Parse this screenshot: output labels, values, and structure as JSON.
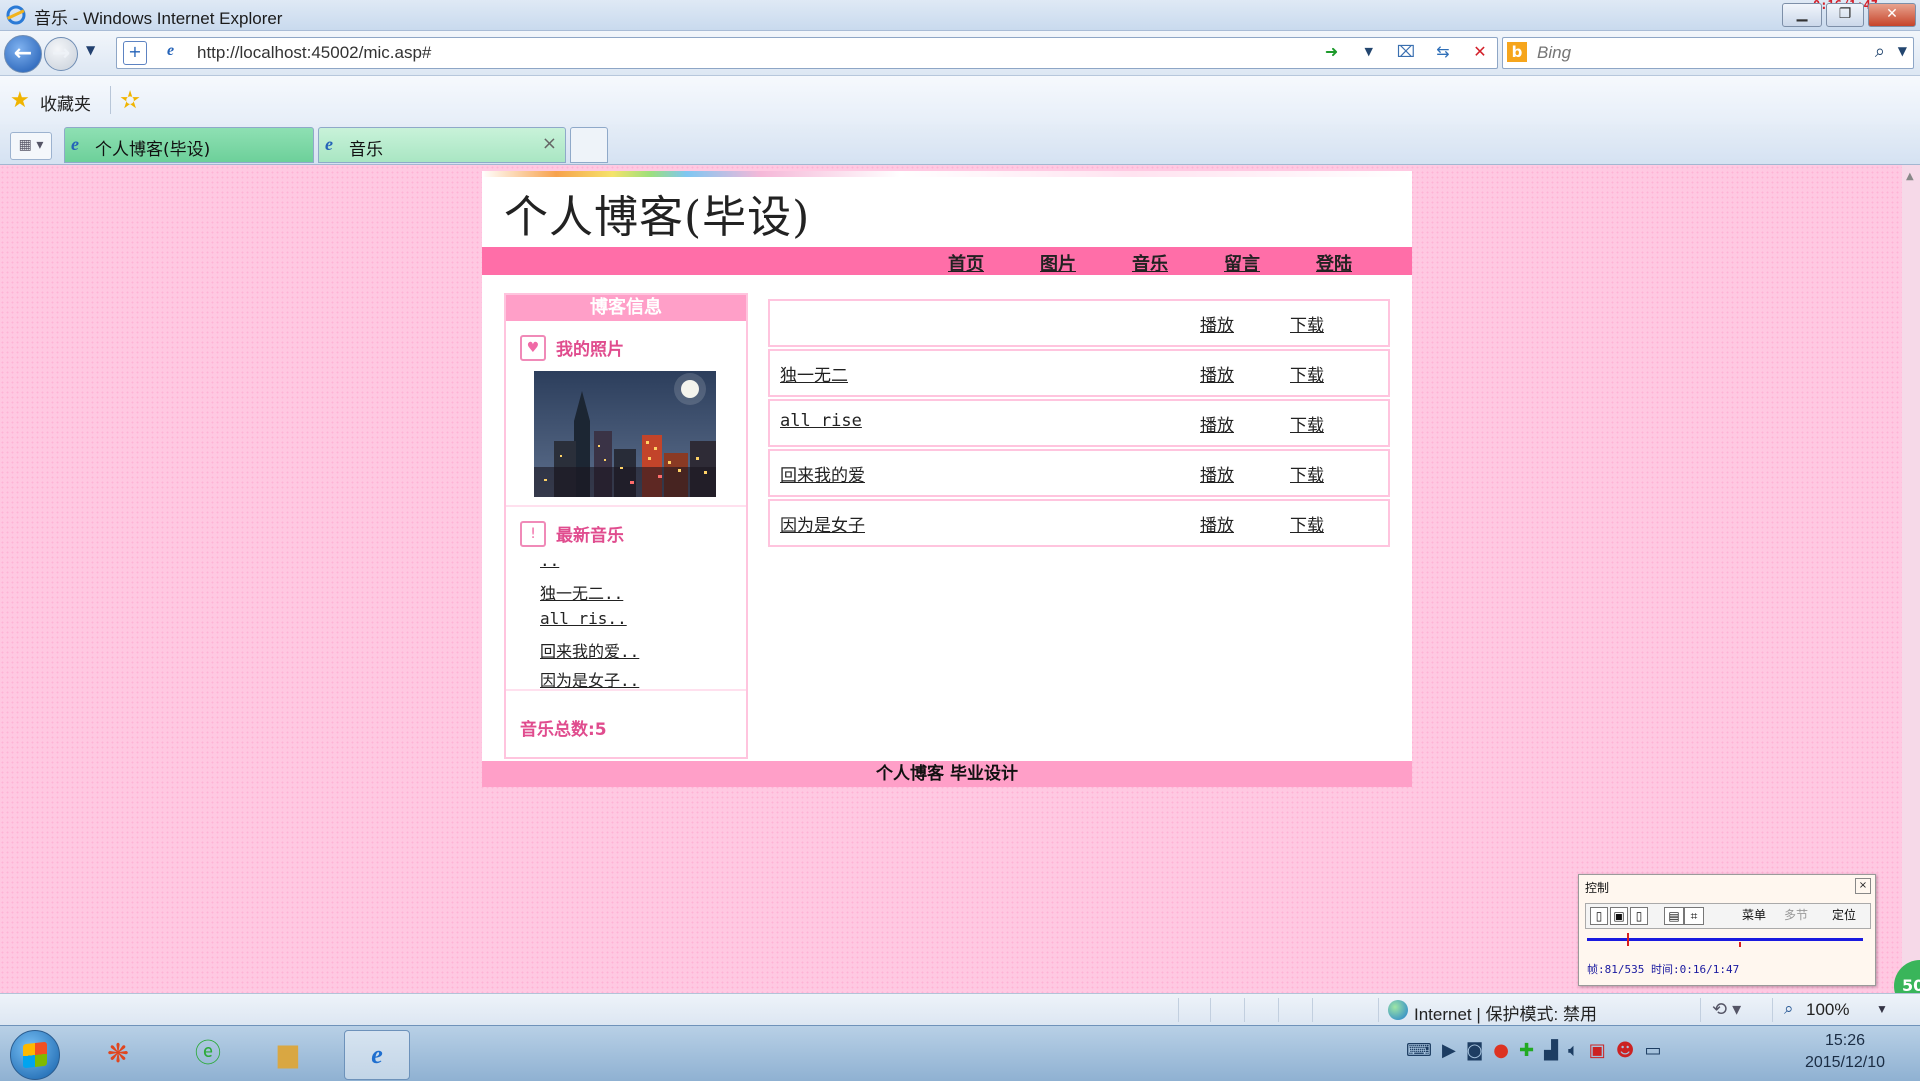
{
  "window": {
    "title": "音乐 - Windows Internet Explorer",
    "recorder_timer": "0:16/1:47"
  },
  "address_bar": {
    "url": "http://localhost:45002/mic.asp#",
    "search_placeholder": "Bing"
  },
  "favorites_bar": {
    "label": "收藏夹"
  },
  "tabs": [
    {
      "label": "个人博客(毕设)",
      "active": false
    },
    {
      "label": "音乐",
      "active": true
    }
  ],
  "page": {
    "title": "个人博客(毕设)",
    "nav": [
      "首页",
      "图片",
      "音乐",
      "留言",
      "登陆"
    ],
    "sidebar": {
      "header": "博客信息",
      "photo_heading": "我的照片",
      "music_heading": "最新音乐",
      "recent_music": [
        "..",
        "独一无二..",
        "all ris..",
        "回来我的爱..",
        "因为是女子.."
      ],
      "total": "音乐总数:5"
    },
    "songs": [
      {
        "name": "",
        "play": "播放",
        "download": "下载"
      },
      {
        "name": "独一无二",
        "play": "播放",
        "download": "下载"
      },
      {
        "name": "all rise",
        "play": "播放",
        "download": "下载"
      },
      {
        "name": "回来我的爱",
        "play": "播放",
        "download": "下载"
      },
      {
        "name": "因为是女子",
        "play": "播放",
        "download": "下载"
      }
    ],
    "footer": "个人博客  毕业设计"
  },
  "recorder_control": {
    "title": "控制",
    "menu_label": "菜单",
    "multi_label": "多节",
    "locate_label": "定位",
    "info": "帧:81/535 时间:0:16/1:47"
  },
  "badge": "50",
  "status_bar": {
    "zone": "Internet | 保护模式: 禁用",
    "zoom": "100%"
  },
  "taskbar": {
    "time": "15:26",
    "date": "2015/12/10"
  },
  "colors": {
    "page_bg": "#ffc9e2",
    "nav_bar": "#ff6ea8",
    "sidebar_header": "#ff9fc8",
    "accent_text": "#e04c8e"
  }
}
